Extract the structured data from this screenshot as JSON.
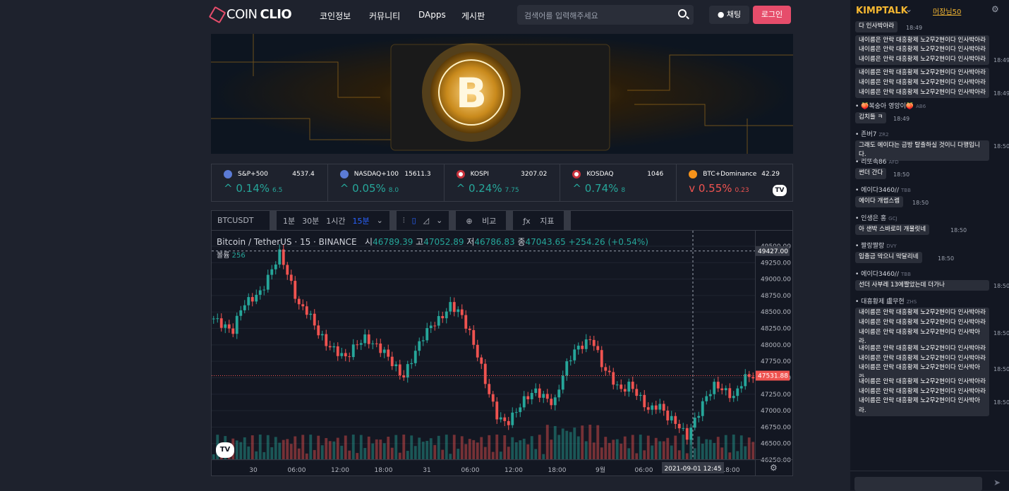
{
  "brand": {
    "name_a": "COIN",
    "name_b": "CLIO"
  },
  "nav": {
    "items": [
      "코인정보",
      "커뮤니티",
      "DApps",
      "게시판"
    ],
    "search_placeholder": "검색어를 입력해주세요",
    "chat_label": "채팅",
    "login_label": "로그인"
  },
  "tickers": [
    {
      "name": "S&P+500",
      "price": "4537.4",
      "change": "0.14%",
      "sub": "6.5",
      "dir": "up"
    },
    {
      "name": "NASDAQ+100",
      "price": "15611.3",
      "change": "0.05%",
      "sub": "8.0",
      "dir": "up"
    },
    {
      "name": "KOSPI",
      "price": "3207.02",
      "change": "0.24%",
      "sub": "7.75",
      "dir": "up"
    },
    {
      "name": "KOSDAQ",
      "price": "1046",
      "change": "0.74%",
      "sub": "8",
      "dir": "up"
    },
    {
      "name": "BTC+Dominance",
      "price": "42.29",
      "change": "0.55%",
      "sub": "0.23",
      "dir": "down"
    }
  ],
  "chart_toolbar": {
    "symbol": "BTCUSDT",
    "intervals": [
      "1분",
      "30분",
      "1시간",
      "15분"
    ],
    "compare": "비교",
    "indicators": "지표"
  },
  "chart_legend": {
    "pair": "Bitcoin / TetherUS · 15 · BINANCE",
    "o_label": "시",
    "o": "46789.39",
    "h_label": "고",
    "h": "47052.89",
    "l_label": "저",
    "l": "46786.83",
    "c_label": "종",
    "c": "47043.65",
    "chg": "+254.26 (+0.54%)",
    "vol_label": "볼륨",
    "vol": "256"
  },
  "chart_data": {
    "type": "candlestick",
    "yticks": [
      "49500.00",
      "49250.00",
      "49000.00",
      "48750.00",
      "48500.00",
      "48250.00",
      "48000.00",
      "47750.00",
      "47500.00",
      "47250.00",
      "47000.00",
      "46750.00",
      "46500.00",
      "46250.00"
    ],
    "xticks": [
      "30",
      "06:00",
      "12:00",
      "18:00",
      "31",
      "06:00",
      "12:00",
      "18:00",
      "9월",
      "06:00",
      "12:00",
      "18:00"
    ],
    "crosshair_price": "49427.00",
    "last_price": "47531.88",
    "crosshair_time": "2021-09-01  12:45",
    "close_path": [
      48400,
      48300,
      48200,
      48600,
      48700,
      48800,
      49100,
      49400,
      49000,
      48600,
      48500,
      48200,
      48000,
      47900,
      47800,
      48000,
      48100,
      48000,
      47900,
      47700,
      47500,
      47800,
      48100,
      48300,
      48400,
      48600,
      48500,
      48200,
      47800,
      47300,
      46900,
      46800,
      47000,
      47200,
      47300,
      47200,
      47100,
      47600,
      47900,
      48000,
      48100,
      47700,
      47500,
      47300,
      47400,
      47200,
      47000,
      47100,
      46900,
      46800,
      46600,
      46900,
      47200,
      47400,
      47300,
      47200,
      47500,
      47531
    ]
  },
  "kimptalk": {
    "title": "KIMPTALK",
    "user": "머장님50",
    "messages": [
      {
        "nick": "",
        "text": "다 인사박아라",
        "time": "18:49"
      },
      {
        "nick": "",
        "text": "내이름은 안락 대흥황제 노2무2현이다 인사박아라내이름은 안락 대흥황제 노2무2현이다 인사박아라내이름은 안락 대흥황제 노2무2현이다 인사박아라",
        "time": "18:49"
      },
      {
        "nick": "",
        "text": "내이름은 안락 대흥황제 노2무2현이다 인사박아라내이름은 안락 대흥황제 노2무2현이다 인사박아라내이름은 안락 대흥황제 노2무2현이다 인사박아라",
        "time": "18:49"
      },
      {
        "nick": "🍑복숭아 영앙이🍑",
        "tag": "AB6",
        "text": "김치들 ㅋ",
        "time": "18:49"
      },
      {
        "nick": "존버7",
        "tag": "ZR2",
        "text": "그래도 에이다는 금방 탈출하실 것이니 다행입니다.",
        "time": "18:50"
      },
      {
        "nick": "리또속86",
        "tag": "AFD",
        "text": "썬더 간다",
        "time": "18:50"
      },
      {
        "nick": "에이다3460//",
        "tag": "TBB",
        "text": "에이다 개썹스렘",
        "time": "18:50"
      },
      {
        "nick": "인생은 홍",
        "tag": "GCJ",
        "text": "아 샌박 스바로미 개물릿네",
        "time": "18:50"
      },
      {
        "nick": "짤랑짤랑",
        "tag": "DVY",
        "text": "입출금 막으니 막달리네",
        "time": "18:50"
      },
      {
        "nick": "에이다3460//",
        "tag": "TBB",
        "text": "선더 사부레 13에짤았는데 더가나",
        "time": "18:50"
      },
      {
        "nick": "대흥황제 盧무현",
        "tag": "ZHS",
        "text": "내이름은 안락 대흥황제 노2무2현이다 인사박아라내이름은 안락 대흥황제 노2무2현이다 인사박아라내이름은 안락 대흥황제 노2무2현이다 인사박아라.",
        "time": "18:50"
      },
      {
        "nick": "",
        "text": "내이름은 안락 대흥황제 노2무2현이다 인사박아라내이름은 안락 대흥황제 노2무2현이다 인사박아라내이름은 안락 대흥황제 노2무2현이다 인사박아라.",
        "time": "18:50"
      },
      {
        "nick": "",
        "text": "내이름은 안락 대흥황제 노2무2현이다 인사박아라내이름은 안락 대흥황제 노2무2현이다 인사박아라내이름은 안락 대흥황제 노2무2현이다 인사박아라.",
        "time": "18:50"
      }
    ]
  }
}
